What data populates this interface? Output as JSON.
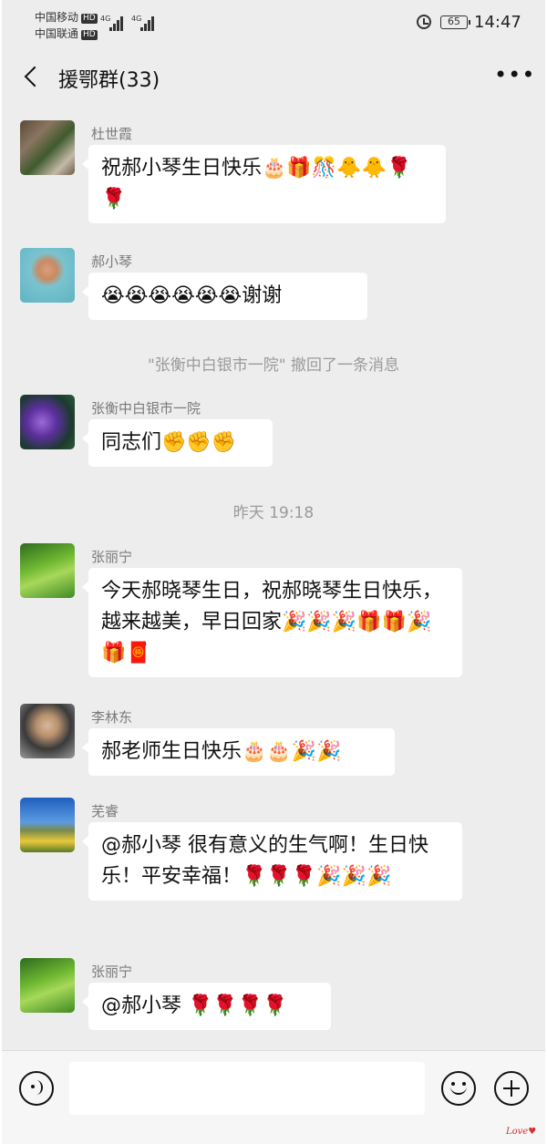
{
  "status_bar": {
    "carrier_1": "中国移动",
    "carrier_2": "中国联通",
    "hd": "HD",
    "net": "4G",
    "battery": "65",
    "time": "14:47"
  },
  "nav": {
    "title": "援鄂群(33)"
  },
  "messages": [
    {
      "sender": "杜世霞",
      "text": "祝郝小琴生日快乐🎂🎁🎊🐥🐥🌹🌹"
    },
    {
      "sender": "郝小琴",
      "text": "😭😭😭😭😭😭谢谢"
    },
    {
      "sender": "张衡中白银市一院",
      "text": "同志们✊✊✊"
    },
    {
      "sender": "张丽宁",
      "text": "今天郝晓琴生日，祝郝晓琴生日快乐，越来越美，早日回家🎉🎉🎉🎁🎁🎉🎁🧧"
    },
    {
      "sender": "李林东",
      "text": "郝老师生日快乐🎂🎂🎉🎉"
    },
    {
      "sender": "芜睿",
      "text": "@郝小琴  很有意义的生气啊！生日快乐！平安幸福！🌹🌹🌹🎉🎉🎉"
    },
    {
      "sender": "张丽宁",
      "text": "@郝小琴  🌹🌹🌹🌹"
    }
  ],
  "system": {
    "recall": "\"张衡中白银市一院\" 撤回了一条消息",
    "timestamp": "昨天 19:18"
  },
  "watermark": "Love"
}
